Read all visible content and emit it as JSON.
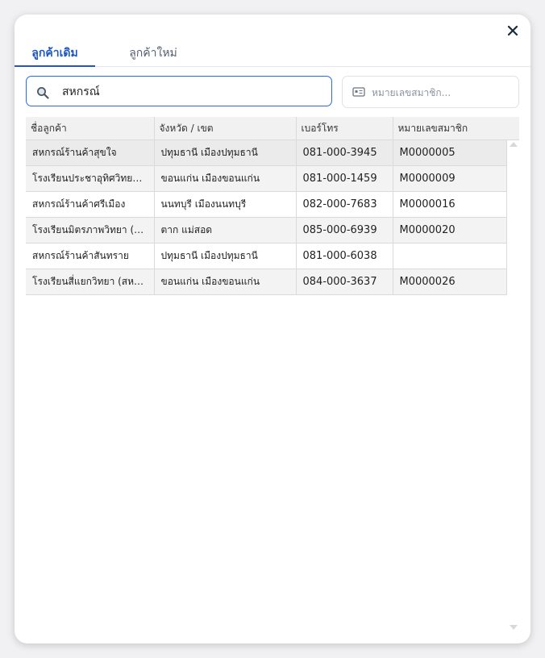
{
  "tabs": [
    {
      "label": "ลูกค้าเดิม",
      "active": true
    },
    {
      "label": "ลูกค้าใหม่",
      "active": false
    }
  ],
  "search": {
    "value": "สหกรณ์",
    "icon": "search-icon"
  },
  "member_search": {
    "placeholder": "หมายเลขสมาชิก...",
    "icon": "id-card-icon"
  },
  "table": {
    "headers": [
      "ชื่อลูกค้า",
      "จังหวัด / เขต",
      "เบอร์โทร",
      "หมายเลขสมาชิก"
    ],
    "rows": [
      {
        "name": "สหกรณ์ร้านค้าสุขใจ",
        "province": "ปทุมธานี เมืองปทุมธานี",
        "phone": "081-000-3945",
        "member": "M0000005"
      },
      {
        "name": "โรงเรียนประชาอุทิศวิทยา...",
        "province": "ขอนแก่น เมืองขอนแก่น",
        "phone": "081-000-1459",
        "member": "M0000009"
      },
      {
        "name": "สหกรณ์ร้านค้าศรีเมือง",
        "province": "นนทบุรี เมืองนนทบุรี",
        "phone": "082-000-7683",
        "member": "M0000016"
      },
      {
        "name": "โรงเรียนมิตรภาพวิทยา (ส...",
        "province": "ตาก แม่สอด",
        "phone": "085-000-6939",
        "member": "M0000020"
      },
      {
        "name": "สหกรณ์ร้านค้าสันทราย",
        "province": "ปทุมธานี เมืองปทุมธานี",
        "phone": "081-000-6038",
        "member": ""
      },
      {
        "name": "โรงเรียนสี่แยกวิทยา (สหก...",
        "province": "ขอนแก่น เมืองขอนแก่น",
        "phone": "084-000-3637",
        "member": "M0000026"
      }
    ]
  },
  "colors": {
    "accent": "#1f57c3",
    "border": "#d8dadd"
  }
}
